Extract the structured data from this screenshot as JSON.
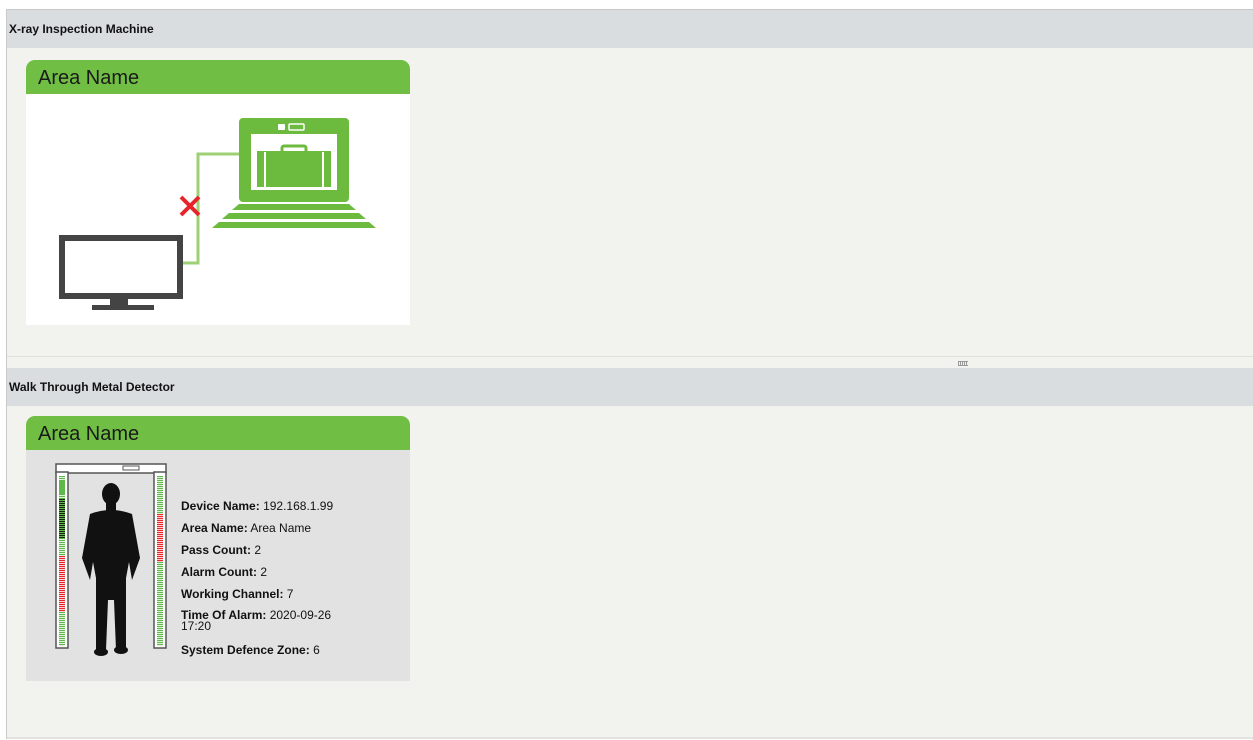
{
  "sections": [
    {
      "title": "X-ray Inspection Machine",
      "card": {
        "title": "Area Name"
      }
    },
    {
      "title": "Walk Through Metal Detector",
      "card": {
        "title": "Area Name"
      }
    }
  ],
  "detector": {
    "device_name_label": "Device Name:",
    "device_name_value": "192.168.1.99",
    "area_name_label": "Area Name:",
    "area_name_value": "Area Name",
    "pass_count_label": "Pass Count:",
    "pass_count_value": "2",
    "alarm_count_label": "Alarm Count:",
    "alarm_count_value": "2",
    "working_channel_label": "Working Channel:",
    "working_channel_value": "7",
    "time_of_alarm_label": "Time Of Alarm:",
    "time_of_alarm_value_date": "2020-09-26",
    "time_of_alarm_value_time": "17:20",
    "defence_zone_label": "System Defence Zone:",
    "defence_zone_value": "6"
  },
  "icons": {
    "xray": "xray-machine-icon",
    "monitor": "monitor-icon",
    "disconnected": "disconnected-x-icon",
    "metal_detector": "walk-through-detector-icon"
  },
  "colors": {
    "accent_green": "#70be44",
    "header_gray": "#dadde0",
    "panel_bg": "#f2f3ef",
    "alarm_red": "#e8242a"
  }
}
